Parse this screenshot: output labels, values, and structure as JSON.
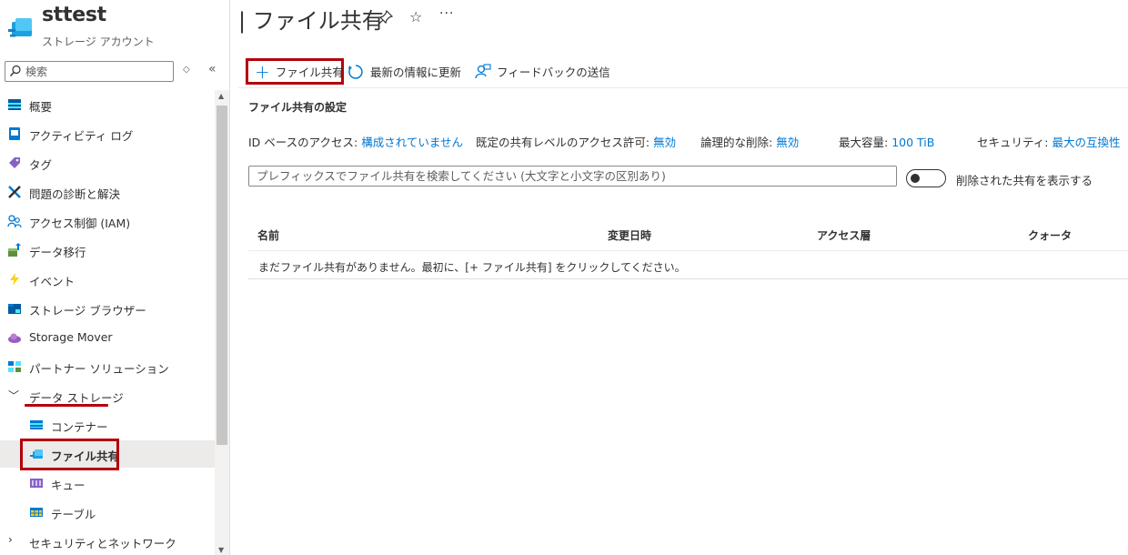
{
  "resource": {
    "name": "sttest",
    "type": "ストレージ アカウント",
    "icon": "storage-file-share-icon"
  },
  "page": {
    "title": "| ファイル共有",
    "pin_icon": "pin-icon",
    "favorite_icon": "star-icon",
    "more_icon": "ellipsis-icon"
  },
  "sidebar": {
    "search": {
      "placeholder": "検索"
    },
    "items": [
      {
        "label": "概要",
        "icon": "overview-icon"
      },
      {
        "label": "アクティビティ ログ",
        "icon": "activity-log-icon"
      },
      {
        "label": "タグ",
        "icon": "tag-icon"
      },
      {
        "label": "問題の診断と解決",
        "icon": "wrench-icon"
      },
      {
        "label": "アクセス制御 (IAM)",
        "icon": "people-icon"
      },
      {
        "label": "データ移行",
        "icon": "data-migration-icon"
      },
      {
        "label": "イベント",
        "icon": "lightning-icon"
      },
      {
        "label": "ストレージ ブラウザー",
        "icon": "storage-browser-icon"
      },
      {
        "label": "Storage Mover",
        "icon": "cloud-icon"
      },
      {
        "label": "パートナー ソリューション",
        "icon": "partner-icon"
      },
      {
        "label": "データ ストレージ",
        "icon": "chevron-down-icon"
      },
      {
        "label": "コンテナー",
        "icon": "container-icon"
      },
      {
        "label": "ファイル共有",
        "icon": "file-share-icon"
      },
      {
        "label": "キュー",
        "icon": "queue-icon"
      },
      {
        "label": "テーブル",
        "icon": "table-icon"
      },
      {
        "label": "セキュリティとネットワーク",
        "icon": "chevron-right-icon"
      }
    ],
    "selected": "ファイル共有"
  },
  "toolbar": {
    "add_label": "ファイル共有",
    "refresh_label": "最新の情報に更新",
    "feedback_label": "フィードバックの送信"
  },
  "settings": {
    "title": "ファイル共有の設定",
    "id_access_key": "ID ベースのアクセス:",
    "id_access_val": "構成されていません",
    "default_share_key": "既定の共有レベルのアクセス許可:",
    "default_share_val": "無効",
    "soft_delete_key": "論理的な削除:",
    "soft_delete_val": "無効",
    "max_capacity_key": "最大容量:",
    "max_capacity_val": "100 TiB",
    "security_key": "セキュリティ:",
    "security_val": "最大の互換性"
  },
  "filter": {
    "placeholder": "プレフィックスでファイル共有を検索してください (大文字と小文字の区別あり)",
    "toggle_label": "削除された共有を表示する",
    "toggle_on": false
  },
  "table": {
    "columns": [
      "名前",
      "変更日時",
      "アクセス層",
      "クォータ"
    ],
    "empty_message": "まだファイル共有がありません。最初に、[+ ファイル共有] をクリックしてください。"
  },
  "colors": {
    "accent": "#0078d4",
    "highlight": "#b3000c"
  }
}
